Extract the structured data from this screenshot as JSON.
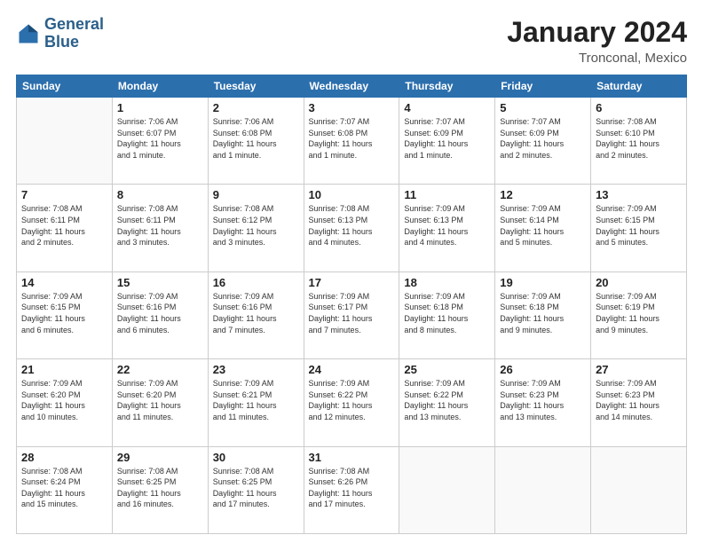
{
  "header": {
    "logo_line1": "General",
    "logo_line2": "Blue",
    "month": "January 2024",
    "location": "Tronconal, Mexico"
  },
  "weekdays": [
    "Sunday",
    "Monday",
    "Tuesday",
    "Wednesday",
    "Thursday",
    "Friday",
    "Saturday"
  ],
  "weeks": [
    [
      {
        "day": "",
        "info": ""
      },
      {
        "day": "1",
        "info": "Sunrise: 7:06 AM\nSunset: 6:07 PM\nDaylight: 11 hours\nand 1 minute."
      },
      {
        "day": "2",
        "info": "Sunrise: 7:06 AM\nSunset: 6:08 PM\nDaylight: 11 hours\nand 1 minute."
      },
      {
        "day": "3",
        "info": "Sunrise: 7:07 AM\nSunset: 6:08 PM\nDaylight: 11 hours\nand 1 minute."
      },
      {
        "day": "4",
        "info": "Sunrise: 7:07 AM\nSunset: 6:09 PM\nDaylight: 11 hours\nand 1 minute."
      },
      {
        "day": "5",
        "info": "Sunrise: 7:07 AM\nSunset: 6:09 PM\nDaylight: 11 hours\nand 2 minutes."
      },
      {
        "day": "6",
        "info": "Sunrise: 7:08 AM\nSunset: 6:10 PM\nDaylight: 11 hours\nand 2 minutes."
      }
    ],
    [
      {
        "day": "7",
        "info": "Sunrise: 7:08 AM\nSunset: 6:11 PM\nDaylight: 11 hours\nand 2 minutes."
      },
      {
        "day": "8",
        "info": "Sunrise: 7:08 AM\nSunset: 6:11 PM\nDaylight: 11 hours\nand 3 minutes."
      },
      {
        "day": "9",
        "info": "Sunrise: 7:08 AM\nSunset: 6:12 PM\nDaylight: 11 hours\nand 3 minutes."
      },
      {
        "day": "10",
        "info": "Sunrise: 7:08 AM\nSunset: 6:13 PM\nDaylight: 11 hours\nand 4 minutes."
      },
      {
        "day": "11",
        "info": "Sunrise: 7:09 AM\nSunset: 6:13 PM\nDaylight: 11 hours\nand 4 minutes."
      },
      {
        "day": "12",
        "info": "Sunrise: 7:09 AM\nSunset: 6:14 PM\nDaylight: 11 hours\nand 5 minutes."
      },
      {
        "day": "13",
        "info": "Sunrise: 7:09 AM\nSunset: 6:15 PM\nDaylight: 11 hours\nand 5 minutes."
      }
    ],
    [
      {
        "day": "14",
        "info": "Sunrise: 7:09 AM\nSunset: 6:15 PM\nDaylight: 11 hours\nand 6 minutes."
      },
      {
        "day": "15",
        "info": "Sunrise: 7:09 AM\nSunset: 6:16 PM\nDaylight: 11 hours\nand 6 minutes."
      },
      {
        "day": "16",
        "info": "Sunrise: 7:09 AM\nSunset: 6:16 PM\nDaylight: 11 hours\nand 7 minutes."
      },
      {
        "day": "17",
        "info": "Sunrise: 7:09 AM\nSunset: 6:17 PM\nDaylight: 11 hours\nand 7 minutes."
      },
      {
        "day": "18",
        "info": "Sunrise: 7:09 AM\nSunset: 6:18 PM\nDaylight: 11 hours\nand 8 minutes."
      },
      {
        "day": "19",
        "info": "Sunrise: 7:09 AM\nSunset: 6:18 PM\nDaylight: 11 hours\nand 9 minutes."
      },
      {
        "day": "20",
        "info": "Sunrise: 7:09 AM\nSunset: 6:19 PM\nDaylight: 11 hours\nand 9 minutes."
      }
    ],
    [
      {
        "day": "21",
        "info": "Sunrise: 7:09 AM\nSunset: 6:20 PM\nDaylight: 11 hours\nand 10 minutes."
      },
      {
        "day": "22",
        "info": "Sunrise: 7:09 AM\nSunset: 6:20 PM\nDaylight: 11 hours\nand 11 minutes."
      },
      {
        "day": "23",
        "info": "Sunrise: 7:09 AM\nSunset: 6:21 PM\nDaylight: 11 hours\nand 11 minutes."
      },
      {
        "day": "24",
        "info": "Sunrise: 7:09 AM\nSunset: 6:22 PM\nDaylight: 11 hours\nand 12 minutes."
      },
      {
        "day": "25",
        "info": "Sunrise: 7:09 AM\nSunset: 6:22 PM\nDaylight: 11 hours\nand 13 minutes."
      },
      {
        "day": "26",
        "info": "Sunrise: 7:09 AM\nSunset: 6:23 PM\nDaylight: 11 hours\nand 13 minutes."
      },
      {
        "day": "27",
        "info": "Sunrise: 7:09 AM\nSunset: 6:23 PM\nDaylight: 11 hours\nand 14 minutes."
      }
    ],
    [
      {
        "day": "28",
        "info": "Sunrise: 7:08 AM\nSunset: 6:24 PM\nDaylight: 11 hours\nand 15 minutes."
      },
      {
        "day": "29",
        "info": "Sunrise: 7:08 AM\nSunset: 6:25 PM\nDaylight: 11 hours\nand 16 minutes."
      },
      {
        "day": "30",
        "info": "Sunrise: 7:08 AM\nSunset: 6:25 PM\nDaylight: 11 hours\nand 17 minutes."
      },
      {
        "day": "31",
        "info": "Sunrise: 7:08 AM\nSunset: 6:26 PM\nDaylight: 11 hours\nand 17 minutes."
      },
      {
        "day": "",
        "info": ""
      },
      {
        "day": "",
        "info": ""
      },
      {
        "day": "",
        "info": ""
      }
    ]
  ]
}
